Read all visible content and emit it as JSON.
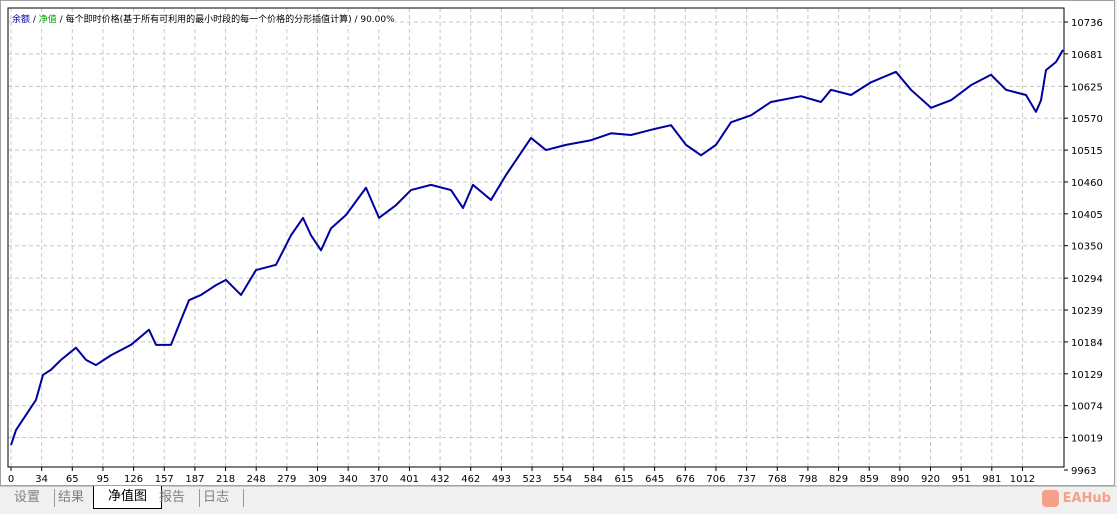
{
  "legend": {
    "balance": "余额",
    "sep1": " / ",
    "equity": "净值",
    "sep2": " / ",
    "model": "每个即时价格(基于所有可利用的最小时段的每一个价格的分形插值计算)",
    "sep3": " / ",
    "quality": "90.00%"
  },
  "tabs": [
    {
      "label": "设置",
      "active": false
    },
    {
      "label": "结果",
      "active": false
    },
    {
      "label": "净值图",
      "active": true
    },
    {
      "label": "报告",
      "active": false
    },
    {
      "label": "日志",
      "active": false
    }
  ],
  "watermark": "EAHub",
  "colors": {
    "balance": "#0000a0",
    "equity": "#00a000",
    "grid": "#c8c8c8"
  },
  "chart_data": {
    "type": "line",
    "title": "",
    "xlabel": "",
    "ylabel": "",
    "x_ticks": [
      0,
      34,
      65,
      95,
      126,
      157,
      187,
      218,
      248,
      279,
      309,
      340,
      370,
      401,
      432,
      462,
      493,
      523,
      554,
      584,
      615,
      645,
      676,
      706,
      737,
      768,
      798,
      829,
      859,
      890,
      920,
      951,
      981,
      1012
    ],
    "y_ticks": [
      9963,
      10019,
      10074,
      10129,
      10184,
      10239,
      10294,
      10350,
      10405,
      10460,
      10515,
      10570,
      10625,
      10681,
      10736
    ],
    "xlim": [
      0,
      1054
    ],
    "ylim": [
      9963,
      10736
    ],
    "grid": true,
    "series": [
      {
        "name": "余额",
        "x": [
          0,
          5,
          15,
          25,
          32,
          40,
          50,
          65,
          75,
          85,
          100,
          120,
          138,
          145,
          160,
          170,
          178,
          190,
          205,
          215,
          230,
          245,
          265,
          280,
          292,
          300,
          310,
          320,
          335,
          355,
          368,
          385,
          400,
          420,
          440,
          452,
          462,
          480,
          495,
          520,
          535,
          555,
          580,
          600,
          620,
          640,
          660,
          675,
          690,
          705,
          720,
          740,
          760,
          790,
          810,
          820,
          840,
          860,
          885,
          900,
          920,
          940,
          960,
          980,
          995,
          1015,
          1025,
          1030,
          1035,
          1045,
          1052
        ],
        "y": [
          10006,
          10032,
          10058,
          10084,
          10127,
          10136,
          10153,
          10174,
          10153,
          10144,
          10161,
          10179,
          10205,
          10179,
          10179,
          10222,
          10256,
          10265,
          10282,
          10291,
          10265,
          10308,
          10317,
          10368,
          10398,
          10368,
          10342,
          10380,
          10403,
          10450,
          10398,
          10420,
          10446,
          10455,
          10446,
          10415,
          10455,
          10429,
          10472,
          10536,
          10515,
          10524,
          10532,
          10544,
          10541,
          10550,
          10558,
          10524,
          10506,
          10524,
          10563,
          10575,
          10598,
          10608,
          10598,
          10619,
          10610,
          10632,
          10650,
          10619,
          10588,
          10601,
          10627,
          10645,
          10619,
          10610,
          10581,
          10601,
          10653,
          10667,
          10688
        ]
      }
    ]
  }
}
